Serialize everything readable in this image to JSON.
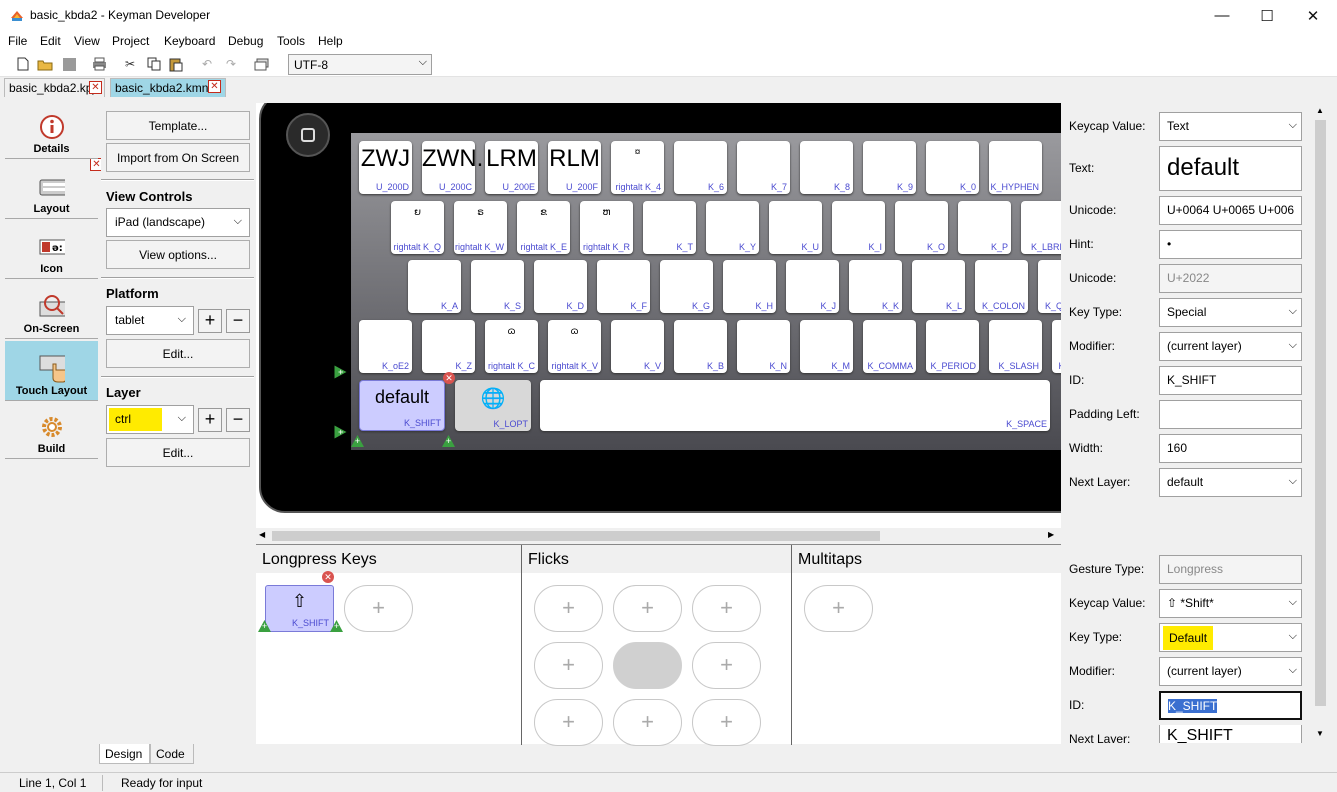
{
  "window": {
    "title": "basic_kbda2 - Keyman Developer",
    "minimize": "—",
    "maximize": "☐",
    "close": "✕"
  },
  "menu": [
    "File",
    "Edit",
    "View",
    "Project",
    "Keyboard",
    "Debug",
    "Tools",
    "Help"
  ],
  "toolbar": {
    "encoding": "UTF-8"
  },
  "file_tabs": [
    {
      "label": "basic_kbda2.kpj",
      "active": false
    },
    {
      "label": "basic_kbda2.kmn",
      "active": true
    }
  ],
  "left_nav": [
    {
      "label": "Details",
      "icon": "info-icon"
    },
    {
      "label": "Layout",
      "icon": "keyboard-icon"
    },
    {
      "label": "Icon",
      "icon": "icon-editor-icon"
    },
    {
      "label": "On-Screen",
      "icon": "onscreen-keyboard-icon"
    },
    {
      "label": "Touch Layout",
      "icon": "touch-icon",
      "active": true
    },
    {
      "label": "Build",
      "icon": "gear-icon"
    }
  ],
  "control_panel": {
    "template_button": "Template...",
    "import_button": "Import from On Screen",
    "view_controls_heading": "View Controls",
    "device": "iPad (landscape)",
    "view_options_button": "View options...",
    "platform_heading": "Platform",
    "platform": "tablet",
    "platform_edit_button": "Edit...",
    "layer_heading": "Layer",
    "layer": "ctrl",
    "layer_edit_button": "Edit..."
  },
  "keyboard": {
    "rows": [
      [
        {
          "cap": "ZWJ",
          "id": "U_200D"
        },
        {
          "cap": "ZWN.",
          "id": "U_200C"
        },
        {
          "cap": "LRM",
          "id": "U_200E"
        },
        {
          "cap": "RLM",
          "id": "U_200F"
        },
        {
          "cap": "¤",
          "id": "rightalt K_4",
          "small": true
        },
        {
          "cap": "",
          "id": "K_6"
        },
        {
          "cap": "",
          "id": "K_7"
        },
        {
          "cap": "",
          "id": "K_8"
        },
        {
          "cap": "",
          "id": "K_9"
        },
        {
          "cap": "",
          "id": "K_0"
        },
        {
          "cap": "",
          "id": "K_HYPHEN"
        }
      ],
      [
        {
          "cap": "ຍ",
          "id": "rightalt K_Q",
          "small": true
        },
        {
          "cap": "ຣ",
          "id": "rightalt K_W",
          "small": true
        },
        {
          "cap": "ຂ",
          "id": "rightalt K_E",
          "small": true
        },
        {
          "cap": "ຫ",
          "id": "rightalt K_R",
          "small": true
        },
        {
          "cap": "",
          "id": "K_T"
        },
        {
          "cap": "",
          "id": "K_Y"
        },
        {
          "cap": "",
          "id": "K_U"
        },
        {
          "cap": "",
          "id": "K_I"
        },
        {
          "cap": "",
          "id": "K_O"
        },
        {
          "cap": "",
          "id": "K_P"
        },
        {
          "cap": "",
          "id": "K_LBRKT"
        }
      ],
      [
        {
          "cap": "",
          "id": "K_A"
        },
        {
          "cap": "",
          "id": "K_S"
        },
        {
          "cap": "",
          "id": "K_D"
        },
        {
          "cap": "",
          "id": "K_F"
        },
        {
          "cap": "",
          "id": "K_G"
        },
        {
          "cap": "",
          "id": "K_H"
        },
        {
          "cap": "",
          "id": "K_J"
        },
        {
          "cap": "",
          "id": "K_K"
        },
        {
          "cap": "",
          "id": "K_L"
        },
        {
          "cap": "",
          "id": "K_COLON"
        },
        {
          "cap": "",
          "id": "K_QUOTE"
        }
      ],
      [
        {
          "cap": "",
          "id": "K_oE2"
        },
        {
          "cap": "",
          "id": "K_Z"
        },
        {
          "cap": "ɷ",
          "id": "rightalt K_C",
          "small": true
        },
        {
          "cap": "ɷ",
          "id": "rightalt K_V",
          "small": true
        },
        {
          "cap": "",
          "id": "K_V"
        },
        {
          "cap": "",
          "id": "K_B"
        },
        {
          "cap": "",
          "id": "K_N"
        },
        {
          "cap": "",
          "id": "K_M"
        },
        {
          "cap": "",
          "id": "K_COMMA"
        },
        {
          "cap": "",
          "id": "K_PERIOD"
        },
        {
          "cap": "",
          "id": "K_SLASH"
        },
        {
          "cap": "",
          "id": "K_RSHIFT"
        }
      ]
    ],
    "bottom_row": [
      {
        "cap": "default",
        "id": "K_SHIFT",
        "selected": true
      },
      {
        "cap": "🌐",
        "id": "K_LOPT"
      },
      {
        "cap": "",
        "id": "K_SPACE"
      }
    ]
  },
  "key_properties": [
    {
      "label": "Keycap Value:",
      "value": "Text",
      "type": "select"
    },
    {
      "label": "Text:",
      "value": "default",
      "type": "bigtext"
    },
    {
      "label": "Unicode:",
      "value": "U+0064 U+0065 U+006",
      "type": "text"
    },
    {
      "label": "Hint:",
      "value": "•",
      "type": "text"
    },
    {
      "label": "Unicode:",
      "value": "U+2022",
      "type": "text",
      "muted": true
    },
    {
      "label": "Key Type:",
      "value": "Special",
      "type": "select"
    },
    {
      "label": "Modifier:",
      "value": "(current layer)",
      "type": "select"
    },
    {
      "label": "ID:",
      "value": "K_SHIFT",
      "type": "text"
    },
    {
      "label": "Padding Left:",
      "value": "",
      "type": "text"
    },
    {
      "label": "Width:",
      "value": "160",
      "type": "text"
    },
    {
      "label": "Next Layer:",
      "value": "default",
      "type": "select"
    }
  ],
  "gesture_columns": {
    "longpress": "Longpress Keys",
    "flicks": "Flicks",
    "multitaps": "Multitaps"
  },
  "longpress_key": {
    "cap": "⇧",
    "id": "K_SHIFT"
  },
  "add_glyph": "+",
  "gesture_properties": [
    {
      "label": "Gesture Type:",
      "value": "Longpress",
      "type": "text",
      "muted": true
    },
    {
      "label": "Keycap Value:",
      "value": "⇧ *Shift*",
      "type": "select"
    },
    {
      "label": "Key Type:",
      "value": "Default",
      "type": "select",
      "highlight": true
    },
    {
      "label": "Modifier:",
      "value": "(current layer)",
      "type": "select"
    },
    {
      "label": "ID:",
      "value": "K_SHIFT",
      "type": "text",
      "focused": true
    },
    {
      "label": "Next Layer:",
      "value": "K_SHIFT",
      "type": "dropdown-item"
    }
  ],
  "bottom_tabs": [
    "Design",
    "Code"
  ],
  "status": {
    "position": "Line 1, Col 1",
    "message": "Ready for input"
  }
}
